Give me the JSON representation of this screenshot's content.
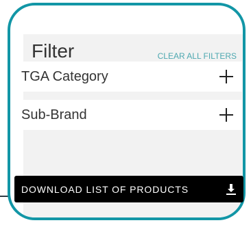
{
  "filter_panel": {
    "title": "Filter",
    "clear_all_label": "CLEAR ALL FILTERS",
    "sections": [
      {
        "label": "TGA Category",
        "icon": "plus-icon"
      },
      {
        "label": "Sub-Brand",
        "icon": "plus-icon"
      }
    ]
  },
  "download": {
    "label": "DOWNLOAD LIST OF PRODUCTS",
    "icon": "download-icon"
  },
  "colors": {
    "frame_border": "#1296a6",
    "panel_bg": "#f2f2f2",
    "accent_link": "#4da8b0",
    "button_bg": "#000000",
    "button_text": "#ffffff"
  }
}
